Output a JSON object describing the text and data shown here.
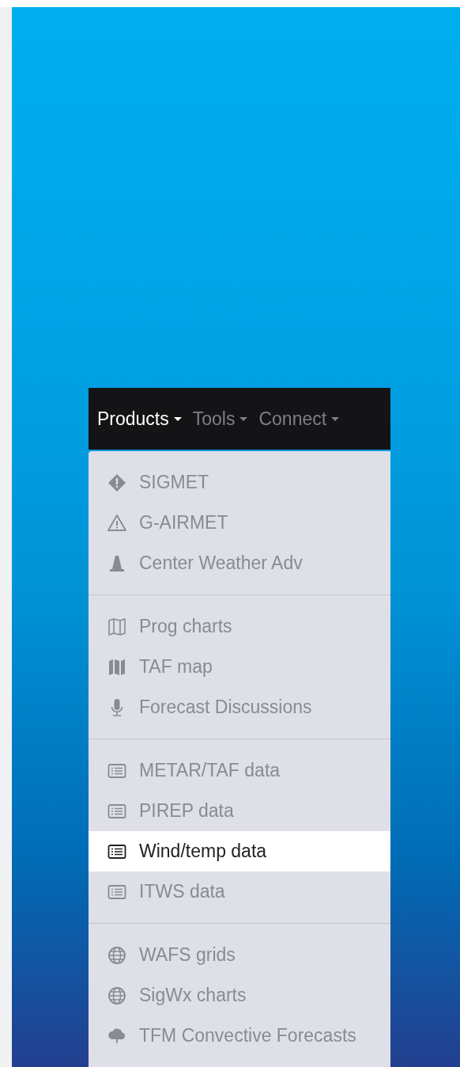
{
  "navbar": {
    "menus": [
      {
        "label": "Products",
        "selected": true
      },
      {
        "label": "Tools",
        "selected": false
      },
      {
        "label": "Connect",
        "selected": false
      }
    ]
  },
  "dropdown": {
    "sections": [
      {
        "items": [
          {
            "label": "SIGMET",
            "kind": "alert",
            "selected": false
          },
          {
            "label": "G-AIRMET",
            "kind": "warning",
            "selected": false
          },
          {
            "label": "Center Weather Adv",
            "kind": "cone",
            "selected": false
          }
        ]
      },
      {
        "items": [
          {
            "label": "Prog charts",
            "kind": "outline",
            "selected": false
          },
          {
            "label": "TAF map",
            "kind": "map",
            "selected": false
          },
          {
            "label": "Forecast Discussions",
            "kind": "microphone",
            "selected": false
          }
        ]
      },
      {
        "items": [
          {
            "label": "METAR/TAF data",
            "kind": "list",
            "selected": false
          },
          {
            "label": "PIREP data",
            "kind": "list",
            "selected": false
          },
          {
            "label": "Wind/temp data",
            "kind": "list",
            "selected": true
          },
          {
            "label": "ITWS data",
            "kind": "list",
            "selected": false
          }
        ]
      },
      {
        "items": [
          {
            "label": "WAFS grids",
            "kind": "globe",
            "selected": false
          },
          {
            "label": "SigWx charts",
            "kind": "globe",
            "selected": false
          },
          {
            "label": "TFM Convective Forecasts",
            "kind": "storm",
            "selected": false
          }
        ]
      }
    ]
  }
}
